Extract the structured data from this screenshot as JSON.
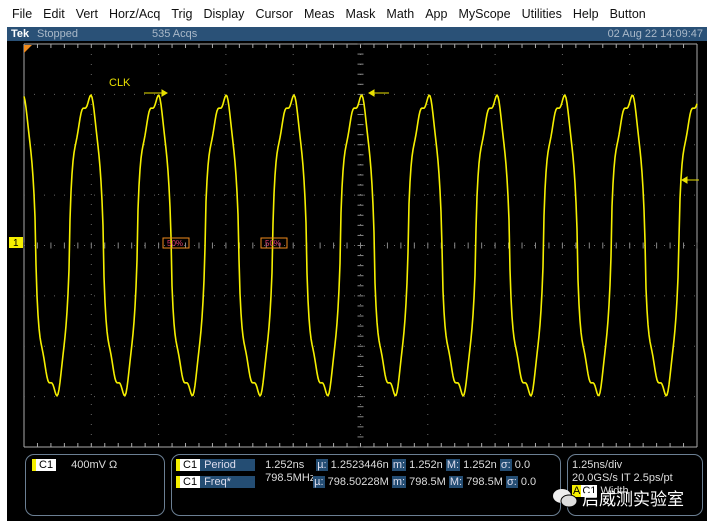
{
  "menu": [
    "File",
    "Edit",
    "Vert",
    "Horz/Acq",
    "Trig",
    "Display",
    "Cursor",
    "Meas",
    "Mask",
    "Math",
    "App",
    "MyScope",
    "Utilities",
    "Help",
    "Button"
  ],
  "status": {
    "brand": "Tek",
    "state": "Stopped",
    "acqs": "535 Acqs",
    "datetime": "02 Aug 22 14:09:47"
  },
  "scope": {
    "trace_label": "CLK",
    "channel_marker": "1",
    "ref_left": "50%",
    "ref_right": "50%",
    "trace_color": "#f5ef00"
  },
  "channel_panel": {
    "channel": "C1",
    "scale": "400mV Ω"
  },
  "measurements": [
    {
      "channel": "C1",
      "name": "Period",
      "value": "1.252ns",
      "mean_label": "µ:",
      "mean": "1.2523446n",
      "min_label": "m:",
      "min": "1.252n",
      "max_label": "M:",
      "max": "1.252n",
      "sd_label": "σ:",
      "sd": "0.0"
    },
    {
      "channel": "C1",
      "name": "Freq*",
      "value": "798.5MHz",
      "mean_label": "µ:",
      "mean": "798.50228M",
      "min_label": "m:",
      "min": "798.5M",
      "max_label": "M:",
      "max": "798.5M",
      "sd_label": "σ:",
      "sd": "0.0"
    }
  ],
  "horizontal": {
    "scale": "1.25ns/div",
    "rate": "20.0GS/s IT 2.5ps/pt",
    "trigger_source": "A",
    "trigger_channel": "C1",
    "trigger_type": "Width"
  },
  "watermark": "启威测实验室"
}
